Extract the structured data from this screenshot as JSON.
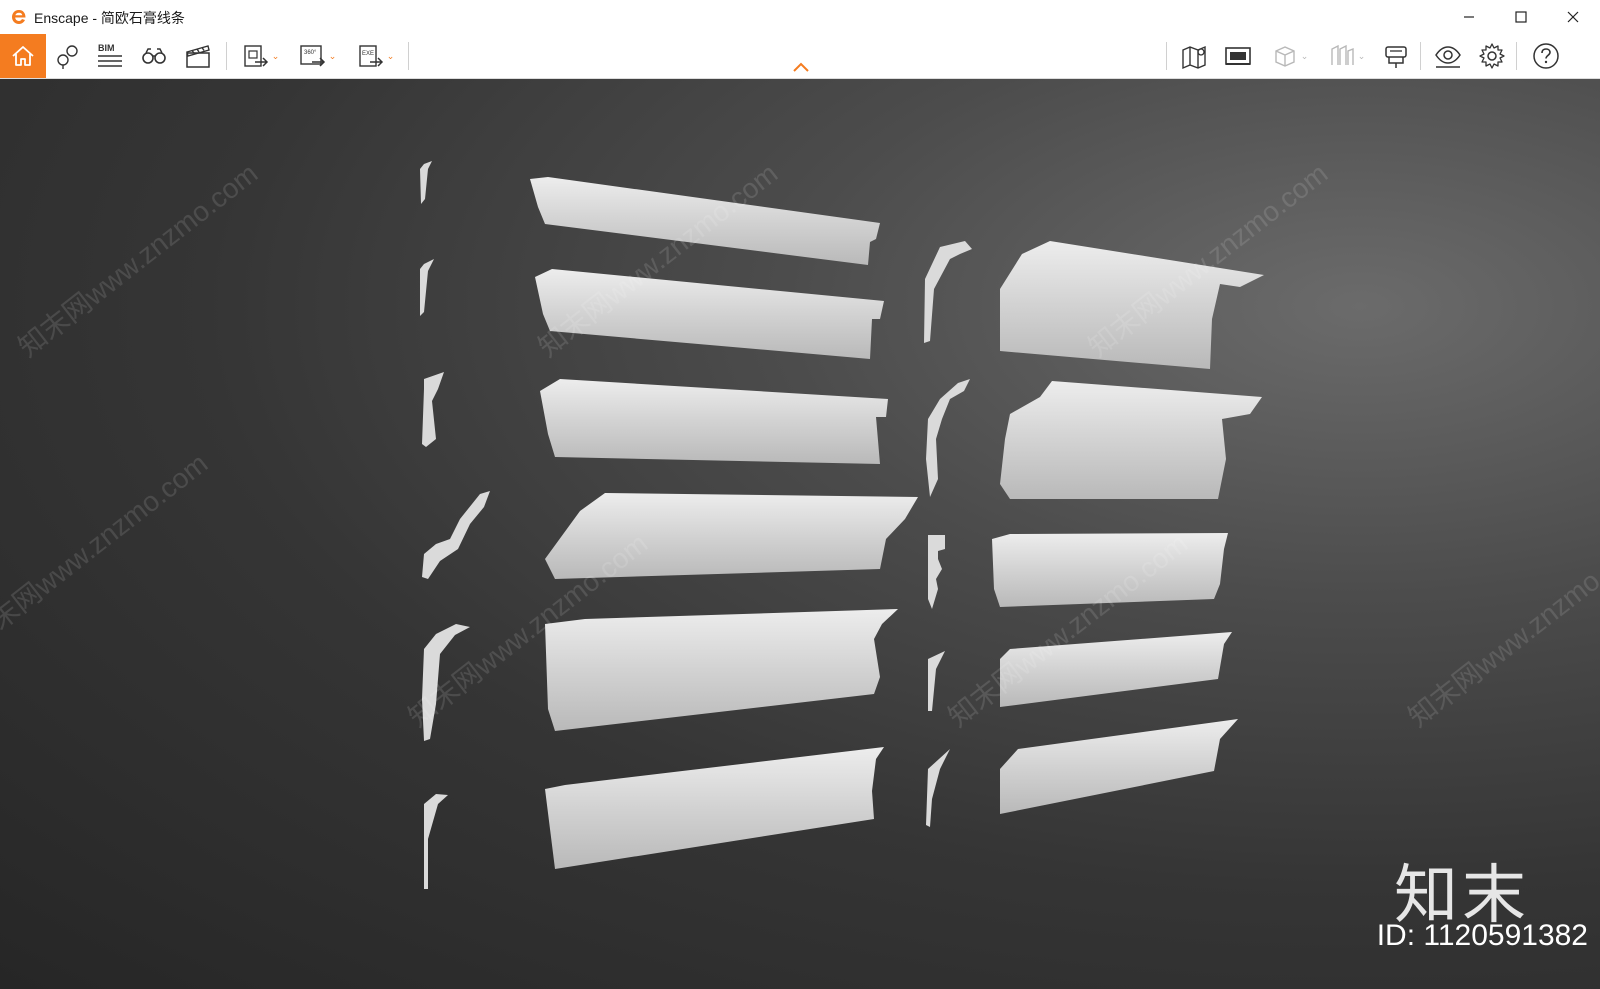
{
  "window": {
    "app_name": "Enscape",
    "title": "Enscape - 简欧石膏线条",
    "accent_color": "#f47c20"
  },
  "toolbar": {
    "left_icons": [
      "home-icon",
      "location-pin-icon",
      "bim-icon",
      "binoculars-icon",
      "clapperboard-icon",
      "export-image-icon",
      "export-panorama-icon",
      "export-exe-icon"
    ],
    "bim_label": "BIM",
    "pano_label": "360°",
    "exe_label": "EXE",
    "right_icons": [
      "map-icon",
      "asset-library-icon",
      "cube-icon",
      "views-icon",
      "material-icon",
      "visibility-icon",
      "gear-icon",
      "help-icon"
    ]
  },
  "watermark": {
    "site_text": "知末网www.znzmo.com",
    "brand": "知末",
    "id_text": "ID: 1120591382"
  }
}
